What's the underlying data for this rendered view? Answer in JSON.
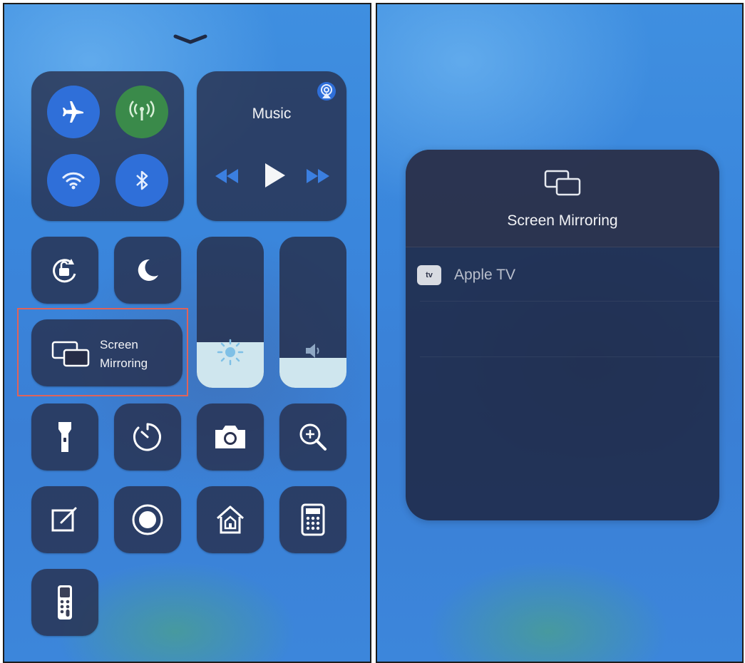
{
  "left_panel": {
    "music": {
      "title": "Music"
    },
    "screen_mirroring_tile": {
      "line1": "Screen",
      "line2": "Mirroring"
    },
    "colors": {
      "airplane_active": "#2f6fd9",
      "cellular_active": "#3a8a4a",
      "wifi_active": "#2f6fd9",
      "bluetooth_active": "#2f6fd9",
      "highlight_box": "#e0635a"
    },
    "brightness_level": 0.3,
    "volume_level": 0.2
  },
  "right_panel": {
    "header": {
      "title": "Screen Mirroring"
    },
    "devices": [
      {
        "badge": "tv",
        "name": "Apple TV"
      }
    ]
  }
}
